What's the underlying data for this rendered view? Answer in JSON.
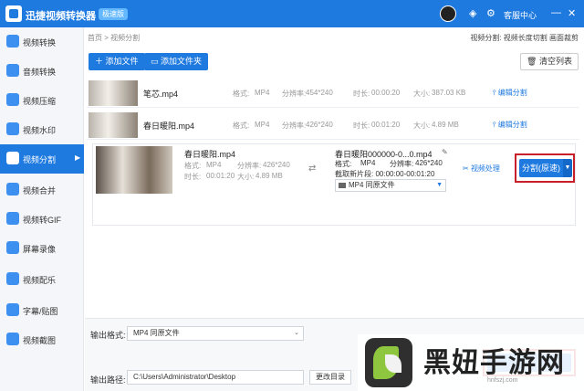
{
  "titlebar": {
    "app_name": "迅捷视频转换器",
    "badge": "极速版",
    "service": "客服中心",
    "window_controls": [
      "⚙",
      "—",
      "✕"
    ]
  },
  "sidebar": {
    "items": [
      {
        "label": "视频转换",
        "icon": "video-convert-icon"
      },
      {
        "label": "音频转换",
        "icon": "audio-convert-icon"
      },
      {
        "label": "视频压缩",
        "icon": "video-compress-icon"
      },
      {
        "label": "视频水印",
        "icon": "video-watermark-icon"
      },
      {
        "label": "视频分割",
        "icon": "video-split-icon",
        "active": true
      },
      {
        "label": "视频合并",
        "icon": "video-merge-icon"
      },
      {
        "label": "视频转GIF",
        "icon": "video-gif-icon"
      },
      {
        "label": "屏幕录像",
        "icon": "screen-record-icon"
      },
      {
        "label": "视频配乐",
        "icon": "video-music-icon"
      },
      {
        "label": "字幕/贴图",
        "icon": "subtitle-icon"
      },
      {
        "label": "视频截图",
        "icon": "video-screenshot-icon"
      }
    ]
  },
  "main": {
    "breadcrumb": "首页 > 视频分割",
    "top_right": "视频分割: 视频长度切割 画面裁剪",
    "add_file": "添加文件",
    "add_folder": "添加文件夹",
    "clear_list": "清空列表",
    "rows": [
      {
        "name": "笔芯.mp4",
        "format_label": "格式:",
        "format": "MP4",
        "res_label": "分辨率:",
        "res": "454*240",
        "dur_label": "时长:",
        "dur": "00:00:20",
        "size_label": "大小:",
        "size": "387.03 KB",
        "action": "编辑分割"
      },
      {
        "name": "春日暖阳.mp4",
        "format_label": "格式:",
        "format": "MP4",
        "res_label": "分辨率:",
        "res": "426*240",
        "dur_label": "时长:",
        "dur": "00:01:20",
        "size_label": "大小:",
        "size": "4.89 MB",
        "action": "编辑分割"
      }
    ],
    "expanded": {
      "src_name": "春日暖阳.mp4",
      "src_format_label": "格式:",
      "src_format": "MP4",
      "src_res_label": "分辨率:",
      "src_res": "426*240",
      "src_dur_label": "时长:",
      "src_dur": "00:01:20",
      "src_size_label": "大小:",
      "src_size": "4.89 MB",
      "dst_name": "春日暖阳000000-0...0.mp4",
      "dst_format_label": "格式:",
      "dst_format": "MP4",
      "dst_res_label": "分辨率:",
      "dst_res": "426*240",
      "dst_range": "截取新片段: 00:00:00-00:01:20",
      "dst_select": "MP4  同原文件",
      "video_proc": "视频处理",
      "split_label": "分割(原速)"
    },
    "bottom": {
      "output_format_label": "输出格式:",
      "output_format": "MP4  同原文件",
      "output_path_label": "输出路径:",
      "output_path": "C:\\Users\\Administrator\\Desktop",
      "change_dir": "更改目录"
    }
  },
  "watermark": {
    "text": "黑妞手游网",
    "url": "hnfszj.com"
  },
  "colors": {
    "accent": "#1f7ae0",
    "highlight": "#c8202a",
    "sidebar_bg": "#f4f6f9"
  }
}
